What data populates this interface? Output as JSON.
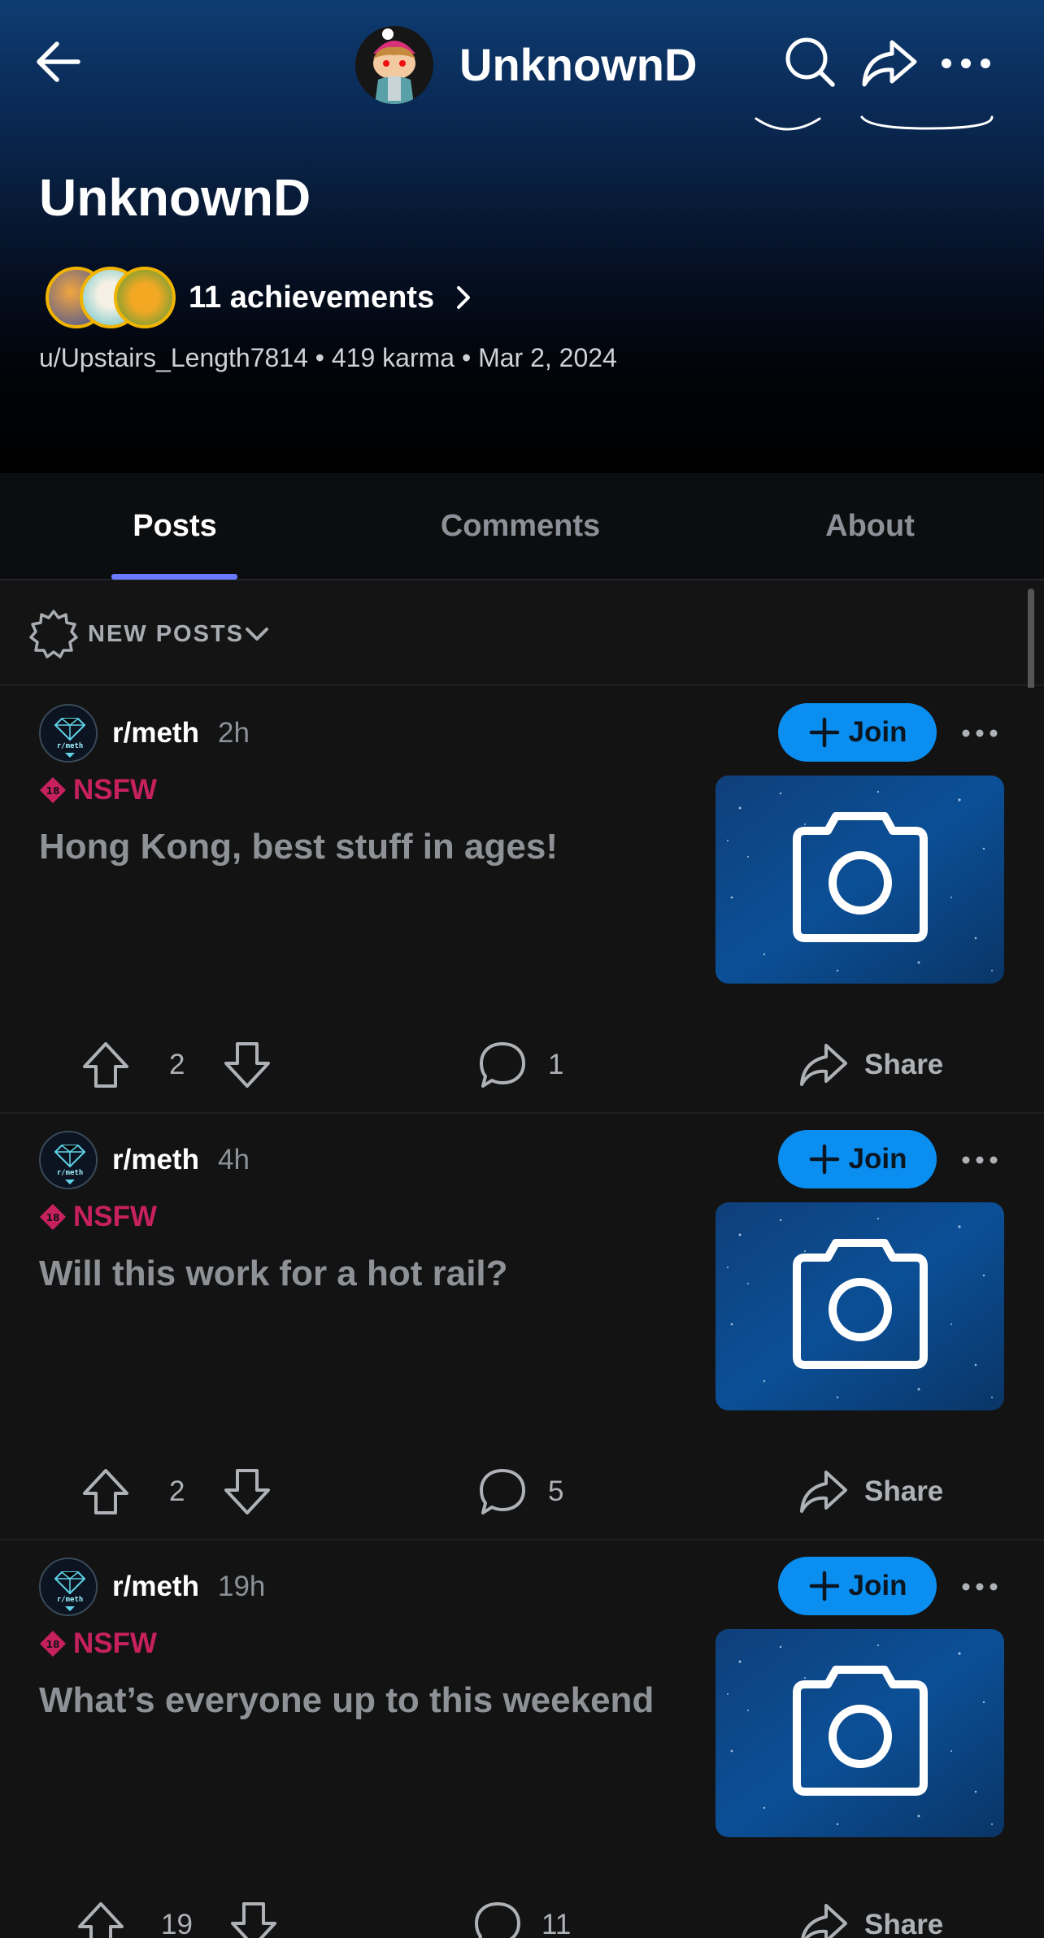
{
  "header": {
    "username_top": "UnknownD",
    "profile_name": "UnknownD",
    "achievements_label": "11 achievements",
    "meta": "u/Upstairs_Length7814 • 419 karma • Mar 2, 2024"
  },
  "tabs": [
    {
      "label": "Posts",
      "active": true
    },
    {
      "label": "Comments",
      "active": false
    },
    {
      "label": "About",
      "active": false
    }
  ],
  "sort": {
    "label": "NEW POSTS"
  },
  "posts": [
    {
      "subreddit": "r/meth",
      "time": "2h",
      "join_label": "Join",
      "nsfw_label": "NSFW",
      "title": "Hong Kong, best stuff in ages!",
      "votes": "2",
      "comments": "1",
      "share_label": "Share"
    },
    {
      "subreddit": "r/meth",
      "time": "4h",
      "join_label": "Join",
      "nsfw_label": "NSFW",
      "title": "Will this work for a hot rail?",
      "votes": "2",
      "comments": "5",
      "share_label": "Share"
    },
    {
      "subreddit": "r/meth",
      "time": "19h",
      "join_label": "Join",
      "nsfw_label": "NSFW",
      "title": "What’s everyone up to this weekend",
      "votes": "19",
      "comments": "11",
      "share_label": "Share"
    }
  ],
  "icons": {
    "back": "back-arrow-icon",
    "search": "search-icon",
    "share": "share-icon",
    "more": "more-icon",
    "sort": "new-burst-icon",
    "upvote": "upvote-icon",
    "downvote": "downvote-icon",
    "comment": "comment-icon",
    "thumbnail": "camera-icon"
  },
  "colors": {
    "accent_blue": "#0a8ef0",
    "tab_indicator": "#6b7bff",
    "nsfw": "#c7215d",
    "background": "#131313"
  }
}
